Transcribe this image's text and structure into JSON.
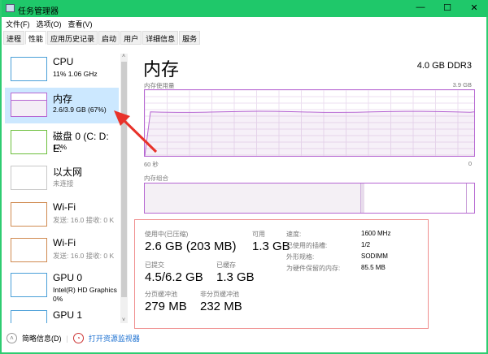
{
  "window": {
    "title": "任务管理器",
    "minimize": "—",
    "maximize": "☐",
    "close": "✕"
  },
  "menu": [
    "文件(F)",
    "选项(O)",
    "查看(V)"
  ],
  "tabs": [
    "进程",
    "性能",
    "应用历史记录",
    "启动",
    "用户",
    "详细信息",
    "服务"
  ],
  "active_tab": 1,
  "sidebar": [
    {
      "name": "CPU",
      "sub": "11%  1.06 GHz",
      "color": "#4a9fd8"
    },
    {
      "name": "内存",
      "sub": "2.6/3.9 GB (67%)",
      "color": "#b666d2",
      "selected": true
    },
    {
      "name": "磁盘 0 (C: D: E:",
      "sub": "12%",
      "color": "#6cbf3c"
    },
    {
      "name": "以太网",
      "sub": "未连接",
      "color": "#c8c8c8"
    },
    {
      "name": "Wi-Fi",
      "sub": "发送: 16.0  接收: 0 K",
      "color": "#d08a50"
    },
    {
      "name": "Wi-Fi",
      "sub": "发送: 16.0  接收: 0 K",
      "color": "#d08a50"
    },
    {
      "name": "GPU 0",
      "sub": "Intel(R) HD Graphics",
      "sub2": "0%",
      "color": "#4a9fd8"
    },
    {
      "name": "GPU 1",
      "sub": "",
      "color": "#4a9fd8"
    }
  ],
  "main": {
    "title": "内存",
    "type": "4.0 GB DDR3",
    "usage_label": "内存使用量",
    "usage_max": "3.9 GB",
    "time_left": "60 秒",
    "time_right": "0",
    "composition_label": "内存组合",
    "usage_fraction": 0.67
  },
  "stats": {
    "in_use_label": "使用中(已压缩)",
    "in_use": "2.6 GB (203 MB)",
    "available_label": "可用",
    "available": "1.3 GB",
    "committed_label": "已提交",
    "committed": "4.5/6.2 GB",
    "cached_label": "已缓存",
    "cached": "1.3 GB",
    "paged_label": "分页缓冲池",
    "paged": "279 MB",
    "nonpaged_label": "非分页缓冲池",
    "nonpaged": "232 MB",
    "props": [
      {
        "k": "速度:",
        "v": "1600 MHz"
      },
      {
        "k": "已使用的插槽:",
        "v": "1/2"
      },
      {
        "k": "外形规格:",
        "v": "SODIMM"
      },
      {
        "k": "为硬件保留的内存:",
        "v": "85.5 MB"
      }
    ]
  },
  "footer": {
    "fewer": "简略信息(D)",
    "monitor": "打开资源监视器"
  }
}
